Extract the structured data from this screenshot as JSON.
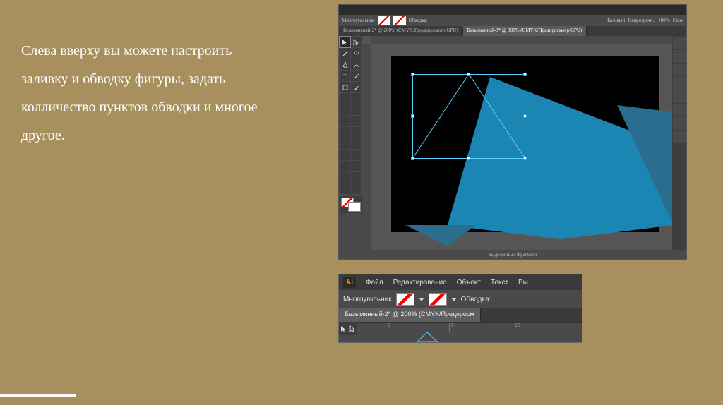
{
  "description": "Слева вверху вы можете настроить заливку и обводку фигуры, задать колличество пунктов обводки и многое другое.",
  "main_screenshot": {
    "controlbar": {
      "tool_label": "Многоугольник",
      "stroke_label": "Обводка:",
      "stroke_value": "",
      "style_label": "Базовый",
      "opacity_label": "Непрозрачн.:",
      "opacity_value": "100%",
      "layers_label": "Слои"
    },
    "tabs": [
      {
        "label": "Безымянный-2* @ 200% (CMYK/Предпросмотр GPU)",
        "active": false
      },
      {
        "label": "Безымянный-3* @ 300% (CMYK/Предпросмотр GPU)",
        "active": true
      }
    ],
    "status": "Выделенный Фрагмент",
    "shape_color_main": "#1b86b3",
    "shape_color_dark": "#2a6d8e",
    "selection_color": "#5bd0ff"
  },
  "detail_screenshot": {
    "app_abbrev": "Ai",
    "menubar": [
      "Файл",
      "Редактирование",
      "Объект",
      "Текст",
      "Вы"
    ],
    "controlbar": {
      "tool_label": "Многоугольник",
      "stroke_label": "Обводка:"
    },
    "tab_label": "Безымянный-2* @ 200% (CMYK/Предпросм",
    "ruler_ticks": [
      "0",
      "5",
      "10"
    ]
  }
}
